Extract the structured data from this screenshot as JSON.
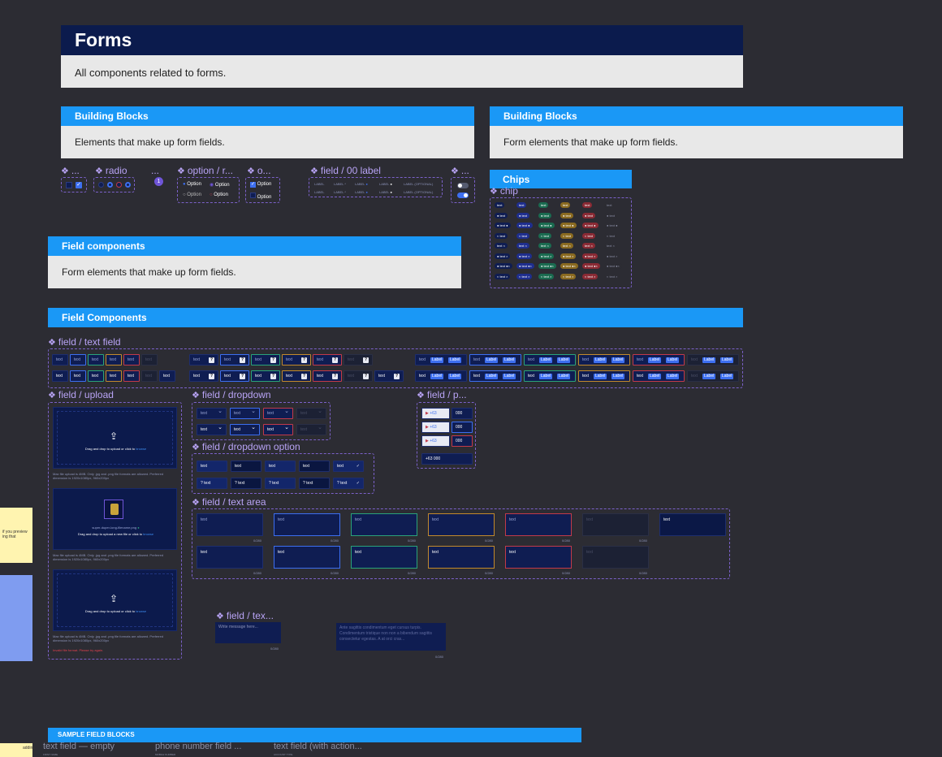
{
  "forms": {
    "title": "Forms",
    "description": "All components related to forms."
  },
  "bb1": {
    "title": "Building Blocks",
    "description": "Elements that make up form fields."
  },
  "bb2": {
    "title": "Building Blocks",
    "description": "Form elements that make up form fields."
  },
  "chips": {
    "title": "Chips",
    "component": "chip",
    "label": "text"
  },
  "fieldcomp_small": {
    "title": "Field components",
    "description": "Form elements that make up form fields."
  },
  "fieldcomp": {
    "title": "Field Components"
  },
  "blocks": {
    "checkbox_title": "...",
    "radio_title": "radio",
    "dots_title": "...",
    "badge_value": "1",
    "option_title": "option / r...",
    "option2_title": "o...",
    "label_title": "field / 00 label",
    "toggle_title": "...",
    "option_label": "Option",
    "label_text": "LABEL",
    "label_req": "LABEL *",
    "label_optional": "LABEL (OPTIONAL)"
  },
  "components": {
    "text_field": "field / text field",
    "upload": "field / upload",
    "dropdown": "field / dropdown",
    "dropdown_option": "field / dropdown option",
    "phone": "field / p...",
    "text_area": "field / text area",
    "text_area2": "field / tex..."
  },
  "field_text": "text",
  "field_label": "Label",
  "phone": {
    "code": "+63",
    "number": "000",
    "full": "+63 000"
  },
  "upload": {
    "drop_text": "Drag and drop to upload or click to",
    "browse": "browse",
    "hint": "Max file upload is 4MB. Only .jpg and .png file formats are allowed. Preferred dimension is 1920x1080px, 960x200px",
    "file_name": "super-duper-long-filename.png",
    "new_file_text": "Drag and drop to upload a new file or click to",
    "error": "Invalid file format. Please try again."
  },
  "textarea": {
    "placeholder": "text",
    "count": "0/280",
    "message_placeholder": "Write message here...",
    "count2": "0/280",
    "long_text": "Ante sagittis condimentum eget cursus turpis. Condimentum tristique non non a bibendum sagittis consectetur egestas. A at orci cras..."
  },
  "sample": {
    "title": "SAMPLE FIELD BLOCKS",
    "col1": "text field — empty",
    "col1_label": "FIRST NAME",
    "col2": "phone number field ...",
    "col2_label": "MOBILE NUMBER",
    "col3": "text field (with action...",
    "col3_label": "ACCOUNT TYPE"
  },
  "sticky": {
    "note1": "if you preview ing that",
    "note2": "adding"
  },
  "colors": {
    "accent": "#1a98f6",
    "dark_header": "#0b1b4d",
    "field_bg": "#0f1d52",
    "purple": "#b9a4f6"
  }
}
